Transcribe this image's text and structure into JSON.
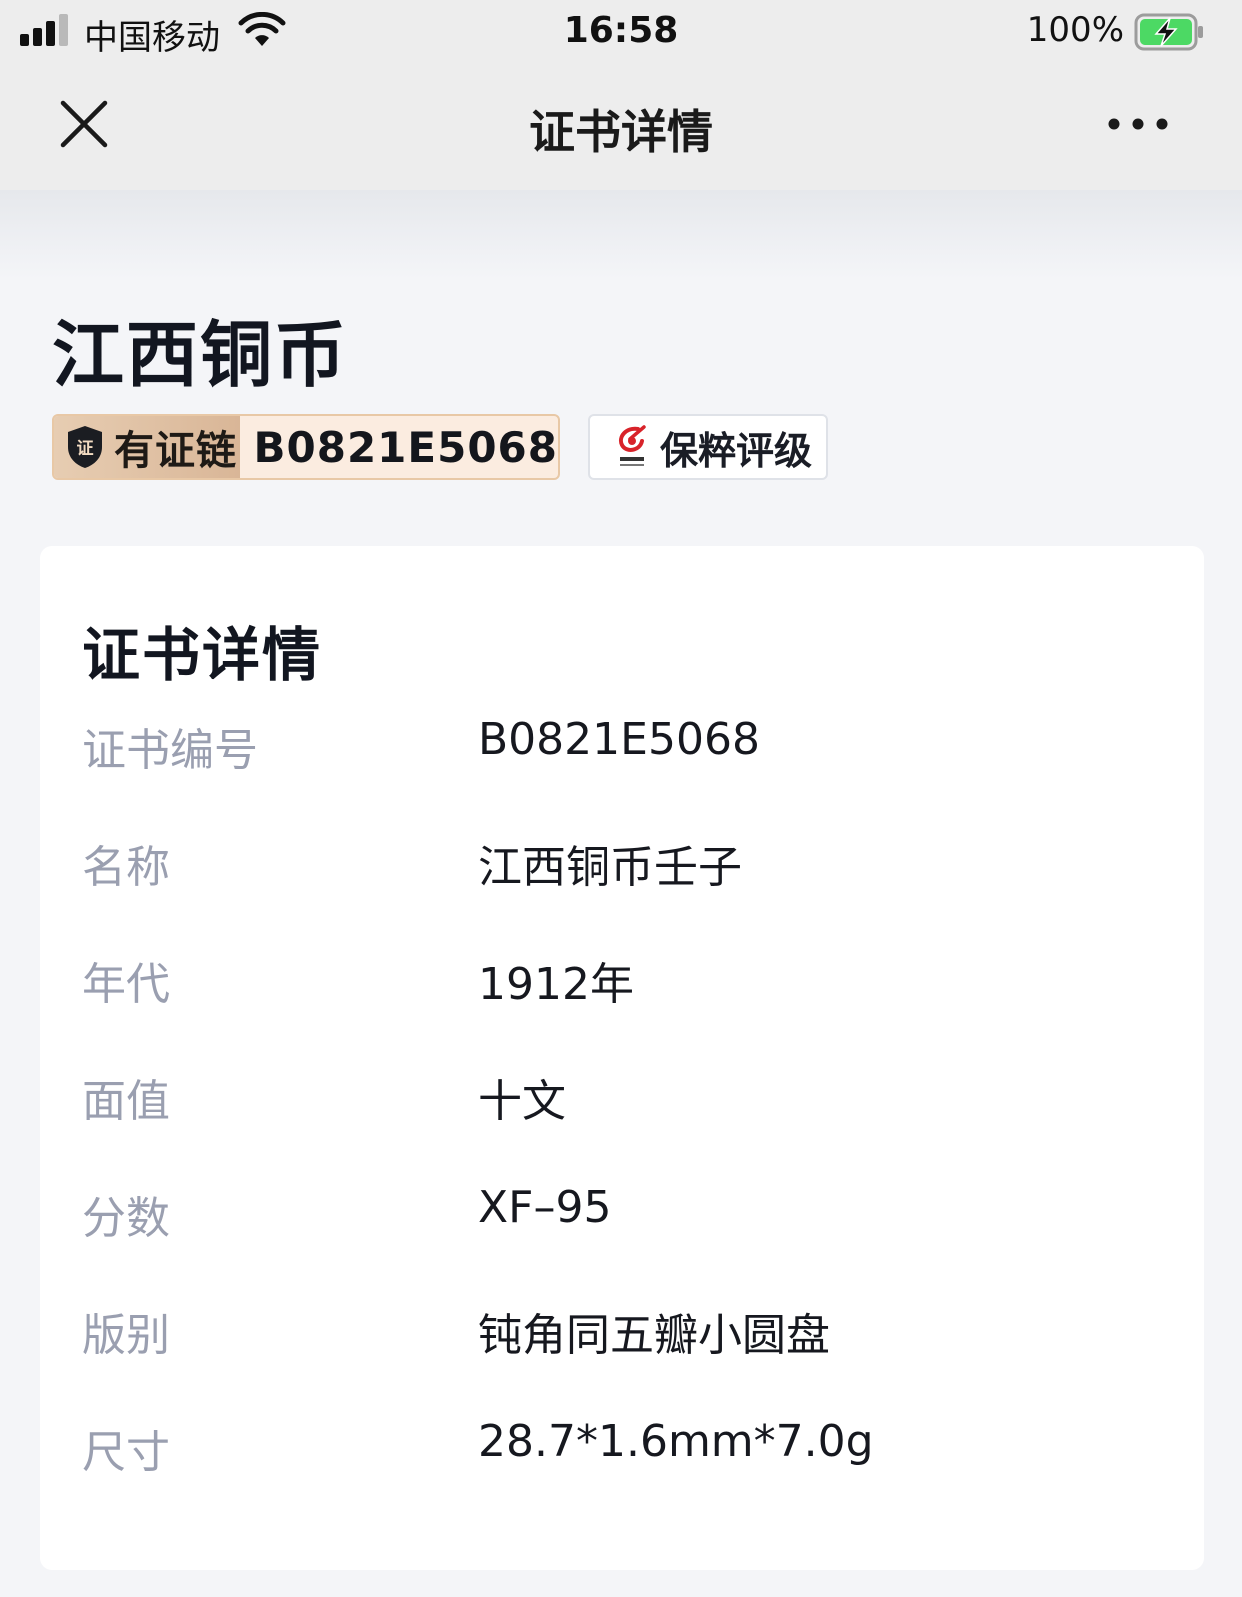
{
  "status_bar": {
    "carrier": "中国移动",
    "time": "16:58",
    "battery_percent": "100%",
    "signal_icon": "cellular-signal-icon",
    "wifi_icon": "wifi-icon",
    "battery_icon": "battery-charging-icon"
  },
  "nav": {
    "title": "证书详情",
    "close_icon": "close-icon",
    "more_icon": "more-icon"
  },
  "item": {
    "title": "江西铜币"
  },
  "badges": {
    "chain_icon_text": "证",
    "chain_label": "有证链",
    "chain_code": "B0821E5068",
    "grader_name": "保粹评级",
    "grader_logo": "grader-logo"
  },
  "card": {
    "title": "证书详情",
    "rows": [
      {
        "label": "证书编号",
        "value": "B0821E5068"
      },
      {
        "label": "名称",
        "value": "江西铜币壬子"
      },
      {
        "label": "年代",
        "value": "1912年"
      },
      {
        "label": "面值",
        "value": "十文"
      },
      {
        "label": "分数",
        "value": "XF–95"
      },
      {
        "label": "版别",
        "value": "钝角同五瓣小圆盘"
      },
      {
        "label": "尺寸",
        "value": "28.7*1.6mm*7.0g"
      }
    ]
  },
  "colors": {
    "background": "#f4f5f8",
    "bar": "#ededed",
    "label_gray": "#9a9fb0",
    "chain_gold": "#d9b697",
    "grader_red": "#d8232a"
  }
}
